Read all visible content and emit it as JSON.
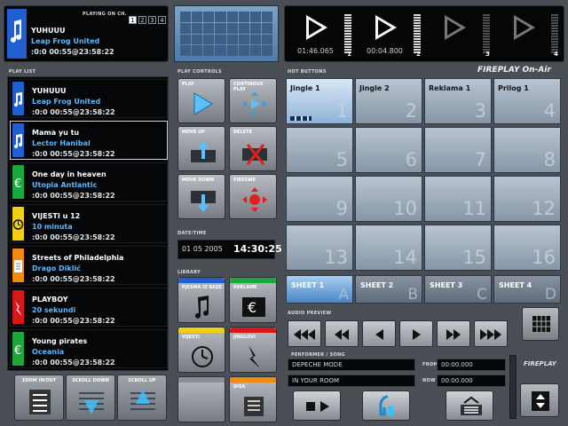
{
  "now_playing": {
    "channel_label": "PLAYING ON CH.",
    "channels": [
      "1",
      "2",
      "3",
      "4"
    ],
    "active_channel": "1",
    "title": "YUHUUU",
    "performer": "Leap Frog United",
    "time": ":0:0 00:55@23:58:22"
  },
  "players": [
    {
      "time": "01:46.065",
      "number": "1",
      "state": "active"
    },
    {
      "time": "00:04.800",
      "number": "2",
      "state": "active"
    },
    {
      "time": "",
      "number": "3",
      "state": "idle"
    },
    {
      "time": "",
      "number": "4",
      "state": "idle"
    }
  ],
  "playlist": {
    "label": "PLAY LIST",
    "items": [
      {
        "title": "YUHUUU",
        "performer": "Leap Frog United",
        "time": ":0:0 00:55@23:58:22",
        "color": "#1f5fd0",
        "icon": "music-note-icon"
      },
      {
        "title": "Mama yu tu",
        "performer": "Lector Hanibal",
        "time": ":0:0 00:55@23:58:22",
        "color": "#1f5fd0",
        "icon": "music-note-icon"
      },
      {
        "title": "One day in heaven",
        "performer": "Utopia Antlantic",
        "time": ":0:0 00:55@23:58:22",
        "color": "#1aa83a",
        "icon": "euro-icon"
      },
      {
        "title": "VIJESTI u 12",
        "performer": "10 minuta",
        "time": ":0:0 00:55@23:58:22",
        "color": "#f0d010",
        "icon": "clock-icon"
      },
      {
        "title": "Streets of Philadelphia",
        "performer": "Drago Diklić",
        "time": ":0:0 00:55@23:58:22",
        "color": "#f08a10",
        "icon": "file-icon"
      },
      {
        "title": "PLAYBOY",
        "performer": "20 sekundi",
        "time": ":0:0 00:55@23:58:22",
        "color": "#d81818",
        "icon": "lightning-icon"
      },
      {
        "title": "Young pirates",
        "performer": "Oceania",
        "time": ":0:0 00:55@23:58:22",
        "color": "#1aa83a",
        "icon": "euro-icon"
      }
    ]
  },
  "bottom_left": {
    "zoom": "ZOOM IN/OUT",
    "scroll_down": "SCROLL DOWN",
    "scroll_up": "SCROLL UP"
  },
  "play_controls": {
    "label": "PLAY CONTROLS",
    "play": "PLAY",
    "continuous": "CONTINOUS PLAY",
    "move_up": "MOVE UP",
    "delete": "DELETE",
    "move_down": "MOVE DOWN",
    "fireswe": "FIRESWE"
  },
  "datetime": {
    "label": "DATE/TIME",
    "date": "01 05 2005",
    "time": "14:30:25"
  },
  "library": {
    "label": "LIBRARY",
    "items": [
      "PJESMA IZ BAZE",
      "REKLAME",
      "VIJESTI",
      "JINGLOVI",
      "",
      "DISK"
    ],
    "colors": [
      "#1f5fd0",
      "#1aa83a",
      "#f0d010",
      "#d81818",
      "#8a8f95",
      "#f08a10"
    ]
  },
  "hot_buttons": {
    "label": "HOT BUTTONS",
    "brand": "FIREPLAY On-Air",
    "cells": [
      {
        "label": "Jingle 1",
        "num": "1"
      },
      {
        "label": "Jingle 2",
        "num": "2"
      },
      {
        "label": "Reklama 1",
        "num": "3"
      },
      {
        "label": "Prilog 1",
        "num": "4"
      },
      {
        "label": "",
        "num": "5"
      },
      {
        "label": "",
        "num": "6"
      },
      {
        "label": "",
        "num": "7"
      },
      {
        "label": "",
        "num": "8"
      },
      {
        "label": "",
        "num": "9"
      },
      {
        "label": "",
        "num": "10"
      },
      {
        "label": "",
        "num": "11"
      },
      {
        "label": "",
        "num": "12"
      },
      {
        "label": "",
        "num": "13"
      },
      {
        "label": "",
        "num": "14"
      },
      {
        "label": "",
        "num": "15"
      },
      {
        "label": "",
        "num": "16"
      }
    ],
    "sheets": [
      {
        "label": "SHEET 1",
        "letter": "A"
      },
      {
        "label": "SHEET 2",
        "letter": "B"
      },
      {
        "label": "SHEET 3",
        "letter": "C"
      },
      {
        "label": "SHEET 4",
        "letter": "D"
      }
    ]
  },
  "audio_preview": {
    "label": "AUDIO PREVIEW",
    "performer_label": "PERFORMER / SONG",
    "performer": "DEPECHE MODE",
    "song": "IN YOUR ROOM",
    "from_label": "FROM",
    "from": "00:00.000",
    "now_label": "NOW",
    "now": "00:00.000"
  },
  "brand_small": "FIREPLAY"
}
